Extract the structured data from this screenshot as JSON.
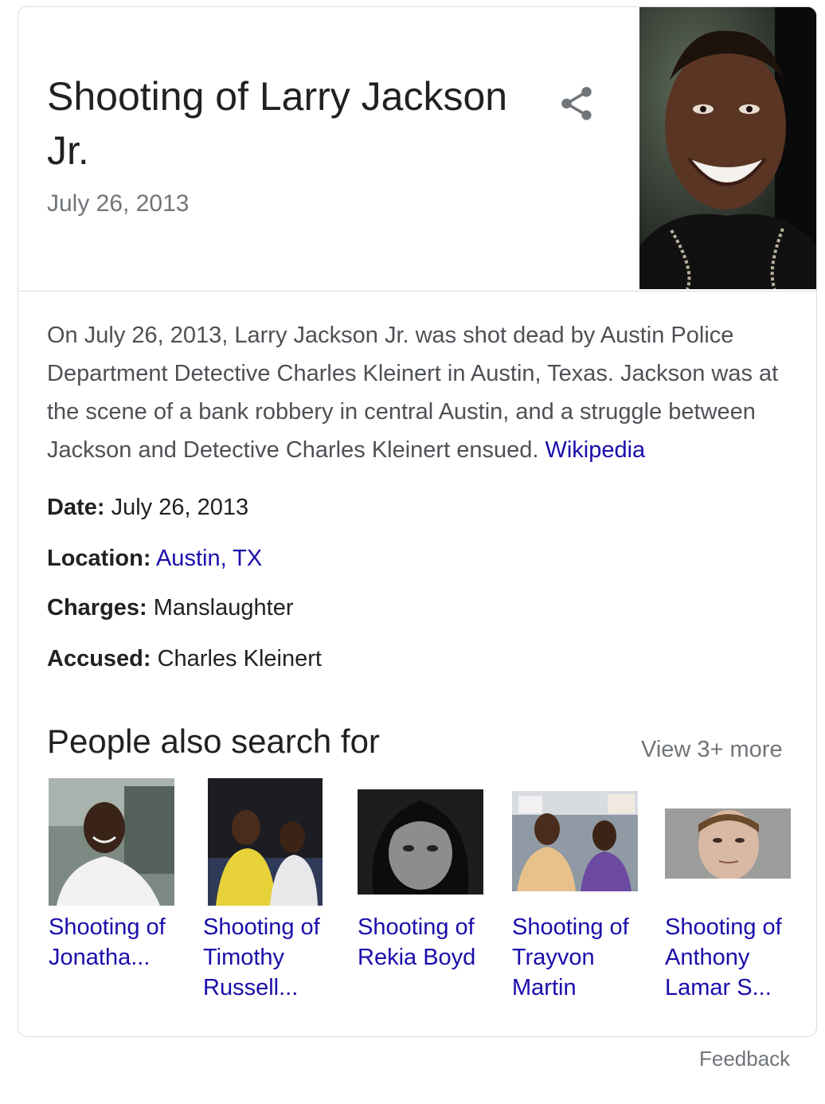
{
  "header": {
    "title": "Shooting of Larry Jackson Jr.",
    "subtitle": "July 26, 2013"
  },
  "description": {
    "text": "On July 26, 2013, Larry Jackson Jr. was shot dead by Austin Police Department Detective Charles Kleinert in Austin, Texas. Jackson was at the scene of a bank robbery in central Austin, and a struggle between Jackson and Detective Charles Kleinert ensued.",
    "source_link": "Wikipedia"
  },
  "facts": [
    {
      "label": "Date:",
      "value": "July 26, 2013",
      "is_link": false
    },
    {
      "label": "Location:",
      "value": "Austin, TX",
      "is_link": true
    },
    {
      "label": "Charges:",
      "value": "Manslaughter",
      "is_link": false
    },
    {
      "label": "Accused:",
      "value": "Charles Kleinert",
      "is_link": false
    }
  ],
  "people_also_search": {
    "title": "People also search for",
    "view_more": "View 3+ more",
    "items": [
      {
        "label": "Shooting of Jonatha..."
      },
      {
        "label": "Shooting of Timothy Russell..."
      },
      {
        "label": "Shooting of Rekia Boyd"
      },
      {
        "label": "Shooting of Trayvon Martin"
      },
      {
        "label": "Shooting of Anthony Lamar S..."
      }
    ]
  },
  "feedback": "Feedback",
  "colors": {
    "link": "#1a0dab",
    "text": "#202124",
    "secondary_text": "#70757a",
    "border": "#dadce0"
  }
}
